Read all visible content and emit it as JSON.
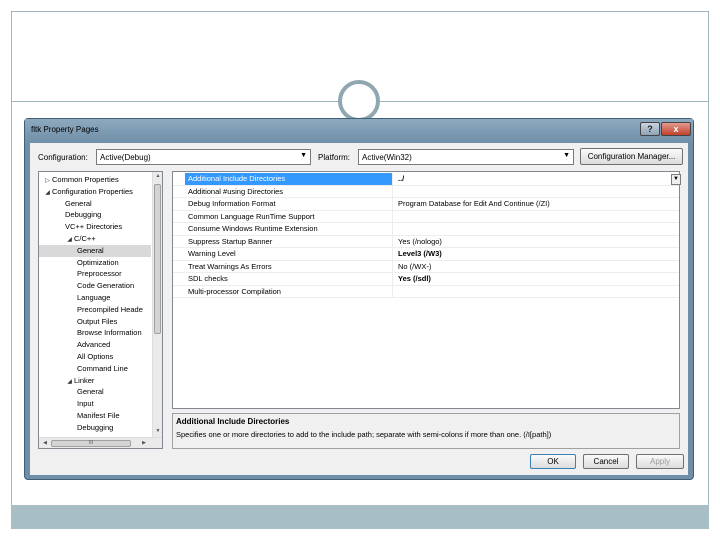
{
  "window": {
    "title": "fltk Property Pages",
    "help_label": "?",
    "close_label": "x"
  },
  "config": {
    "configuration_label": "Configuration:",
    "configuration_value": "Active(Debug)",
    "platform_label": "Platform:",
    "platform_value": "Active(Win32)",
    "manager_button": "Configuration Manager..."
  },
  "tree": {
    "items": [
      {
        "label": "Common Properties",
        "glyph": "▷"
      },
      {
        "label": "Configuration Properties",
        "glyph": "◢"
      },
      {
        "label": "General",
        "glyph": ""
      },
      {
        "label": "Debugging",
        "glyph": ""
      },
      {
        "label": "VC++ Directories",
        "glyph": ""
      },
      {
        "label": "C/C++",
        "glyph": "◢"
      },
      {
        "label": "General",
        "glyph": ""
      },
      {
        "label": "Optimization",
        "glyph": ""
      },
      {
        "label": "Preprocessor",
        "glyph": ""
      },
      {
        "label": "Code Generation",
        "glyph": ""
      },
      {
        "label": "Language",
        "glyph": ""
      },
      {
        "label": "Precompiled Heade",
        "glyph": ""
      },
      {
        "label": "Output Files",
        "glyph": ""
      },
      {
        "label": "Browse Information",
        "glyph": ""
      },
      {
        "label": "Advanced",
        "glyph": ""
      },
      {
        "label": "All Options",
        "glyph": ""
      },
      {
        "label": "Command Line",
        "glyph": ""
      },
      {
        "label": "Linker",
        "glyph": "◢"
      },
      {
        "label": "General",
        "glyph": ""
      },
      {
        "label": "Input",
        "glyph": ""
      },
      {
        "label": "Manifest File",
        "glyph": ""
      },
      {
        "label": "Debugging",
        "glyph": ""
      }
    ],
    "hscroll_thumb": "III"
  },
  "properties": [
    {
      "name": "Additional Include Directories",
      "value": "../",
      "bold": true,
      "selected": true
    },
    {
      "name": "Additional #using Directories",
      "value": "",
      "bold": false,
      "selected": false
    },
    {
      "name": "Debug Information Format",
      "value": "Program Database for Edit And Continue (/ZI)",
      "bold": false,
      "selected": false
    },
    {
      "name": "Common Language RunTime Support",
      "value": "",
      "bold": false,
      "selected": false
    },
    {
      "name": "Consume Windows Runtime Extension",
      "value": "",
      "bold": false,
      "selected": false
    },
    {
      "name": "Suppress Startup Banner",
      "value": "Yes (/nologo)",
      "bold": false,
      "selected": false
    },
    {
      "name": "Warning Level",
      "value": "Level3 (/W3)",
      "bold": true,
      "selected": false
    },
    {
      "name": "Treat Warnings As Errors",
      "value": "No (/WX-)",
      "bold": false,
      "selected": false
    },
    {
      "name": "SDL checks",
      "value": "Yes (/sdl)",
      "bold": true,
      "selected": false
    },
    {
      "name": "Multi-processor Compilation",
      "value": "",
      "bold": false,
      "selected": false
    }
  ],
  "description": {
    "title": "Additional Include Directories",
    "text": "Specifies one or more directories to add to the include path; separate with semi-colons if more than one.     (/I[path])"
  },
  "buttons": {
    "ok": "OK",
    "cancel": "Cancel",
    "apply": "Apply"
  },
  "colors": {
    "selection": "#3399ff",
    "title_bar": "#6f8fa8",
    "slide_accent": "#a7bec4"
  }
}
